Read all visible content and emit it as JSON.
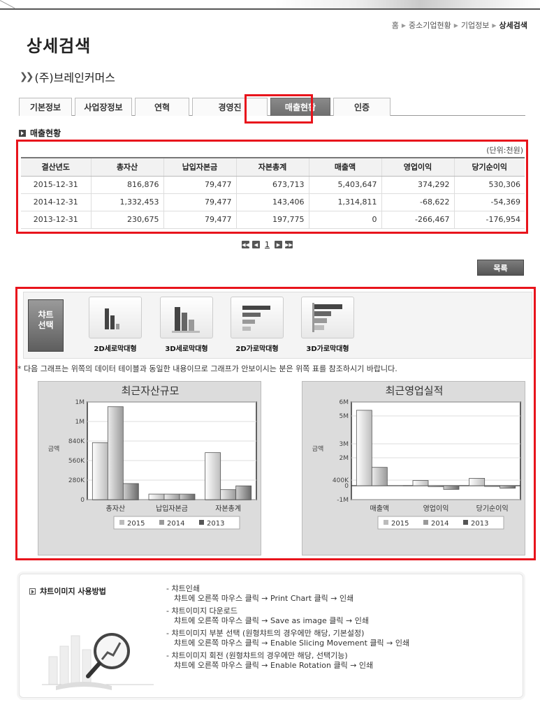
{
  "breadcrumb": [
    "홈",
    "중소기업현황",
    "기업정보",
    "상세검색"
  ],
  "page_title": "상세검색",
  "company_name": "(주)브레인커머스",
  "tabs": [
    {
      "label": "기본정보",
      "active": false
    },
    {
      "label": "사업장정보",
      "active": false
    },
    {
      "label": "연혁",
      "active": false
    },
    {
      "label": "경영진",
      "active": false
    },
    {
      "label": "매출현황",
      "active": true
    },
    {
      "label": "인증",
      "active": false
    }
  ],
  "section_title": "매출현황",
  "unit": "(단위:천원)",
  "table": {
    "headers": [
      "결산년도",
      "총자산",
      "납입자본금",
      "자본총계",
      "매출액",
      "영업이익",
      "당기순이익"
    ],
    "rows": [
      [
        "2015-12-31",
        "816,876",
        "79,477",
        "673,713",
        "5,403,647",
        "374,292",
        "530,306"
      ],
      [
        "2014-12-31",
        "1,332,453",
        "79,477",
        "143,406",
        "1,314,811",
        "-68,622",
        "-54,369"
      ],
      [
        "2013-12-31",
        "230,675",
        "79,477",
        "197,775",
        "0",
        "-266,467",
        "-176,954"
      ]
    ]
  },
  "pager": {
    "current": "1"
  },
  "list_button": "목록",
  "chart_selector": {
    "label_line1": "챠트",
    "label_line2": "선택",
    "options": [
      "2D세로막대형",
      "3D세로막대형",
      "2D가로막대형",
      "3D가로막대형"
    ]
  },
  "notice": "* 다음 그래프는 위쪽의 데이터 테이블과 동일한 내용이므로 그래프가 안보이시는 분은 위쪽 표를 참조하시기 바랍니다.",
  "chart_data": [
    {
      "type": "bar",
      "title": "최근자산규모",
      "ylabel": "금액",
      "categories": [
        "총자산",
        "납입자본금",
        "자본총계"
      ],
      "series": [
        {
          "name": "2015",
          "values": [
            816876,
            79477,
            673713
          ]
        },
        {
          "name": "2014",
          "values": [
            1332453,
            79477,
            143406
          ]
        },
        {
          "name": "2013",
          "values": [
            230675,
            79477,
            197775
          ]
        }
      ],
      "yticks": [
        "0",
        "280K",
        "560K",
        "840K",
        "1M",
        "1M"
      ],
      "ylim": [
        0,
        1400000
      ]
    },
    {
      "type": "bar",
      "title": "최근영업실적",
      "ylabel": "금액",
      "categories": [
        "매출액",
        "영업이익",
        "당기순이익"
      ],
      "series": [
        {
          "name": "2015",
          "values": [
            5403647,
            374292,
            530306
          ]
        },
        {
          "name": "2014",
          "values": [
            1314811,
            -68622,
            -54369
          ]
        },
        {
          "name": "2013",
          "values": [
            0,
            -266467,
            -176954
          ]
        }
      ],
      "yticks": [
        "-1M",
        "0",
        "400K",
        "2M",
        "3M",
        "5M",
        "6M"
      ],
      "ylim": [
        -1000000,
        6000000
      ]
    }
  ],
  "howto": {
    "title": "챠트이미지 사용방법",
    "items": [
      {
        "head": "- 챠트인쇄",
        "desc": "챠트에 오른쪽 마우스 클릭 → Print Chart 클릭 → 인쇄"
      },
      {
        "head": "- 챠트이미지 다운로드",
        "desc": "챠트에 오른쪽 마우스 클릭 → Save as image 클릭 → 인쇄"
      },
      {
        "head": "- 챠트이미지 부분 선택 (원형챠트의 경우에만 해당, 기본설정)",
        "desc": "챠트에 오른쪽 마우스 클릭 → Enable Slicing Movement 클릭 → 인쇄"
      },
      {
        "head": "- 챠트이미지 회전 (원형챠트의 경우에만 해당, 선택기능)",
        "desc": "챠트에 오른쪽 마우스 클릭 → Enable Rotation 클릭 → 인쇄"
      }
    ]
  }
}
